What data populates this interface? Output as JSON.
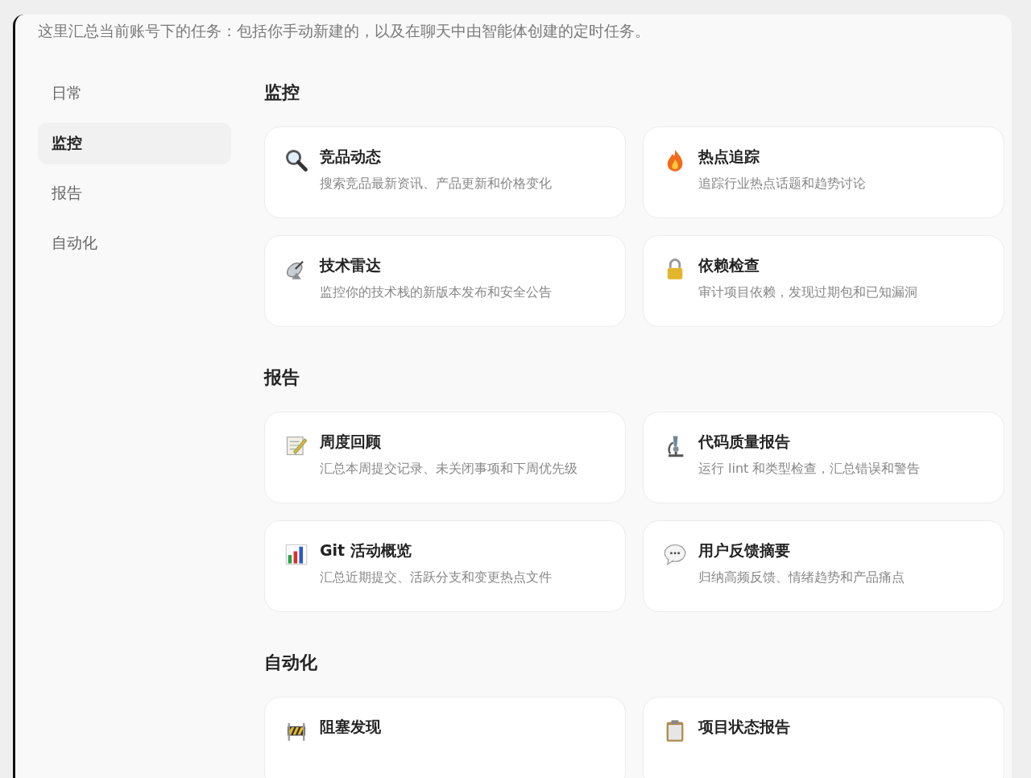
{
  "intro": "这里汇总当前账号下的任务：包括你手动新建的，以及在聊天中由智能体创建的定时任务。",
  "sidebar": {
    "items": [
      {
        "label": "日常",
        "selected": false
      },
      {
        "label": "监控",
        "selected": true
      },
      {
        "label": "报告",
        "selected": false
      },
      {
        "label": "自动化",
        "selected": false
      }
    ]
  },
  "sections": [
    {
      "title": "监控",
      "cards": [
        {
          "title": "竞品动态",
          "description": "搜索竞品最新资讯、产品更新和价格变化"
        },
        {
          "title": "热点追踪",
          "description": "追踪行业热点话题和趋势讨论"
        },
        {
          "title": "技术雷达",
          "description": "监控你的技术栈的新版本发布和安全公告"
        },
        {
          "title": "依赖检查",
          "description": "审计项目依赖，发现过期包和已知漏洞"
        }
      ]
    },
    {
      "title": "报告",
      "cards": [
        {
          "title": "周度回顾",
          "description": "汇总本周提交记录、未关闭事项和下周优先级"
        },
        {
          "title": "代码质量报告",
          "description": "运行 lint 和类型检查，汇总错误和警告"
        },
        {
          "title": "Git 活动概览",
          "description": "汇总近期提交、活跃分支和变更热点文件"
        },
        {
          "title": "用户反馈摘要",
          "description": "归纳高频反馈、情绪趋势和产品痛点"
        }
      ]
    },
    {
      "title": "自动化",
      "cards": [
        {
          "title": "阻塞发现"
        },
        {
          "title": "项目状态报告"
        }
      ]
    }
  ]
}
